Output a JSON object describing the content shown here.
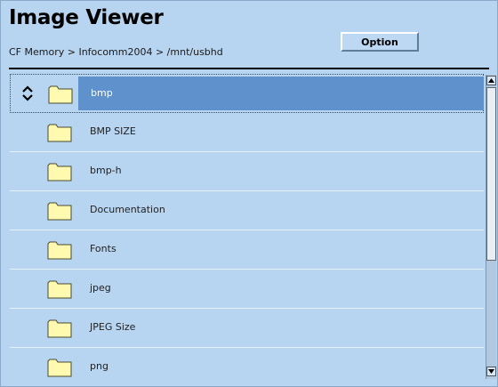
{
  "app": {
    "title": "Image Viewer",
    "breadcrumb": "CF Memory > Infocomm2004 > /mnt/usbhd",
    "option_label": "Option"
  },
  "list": {
    "items": [
      {
        "label": "bmp",
        "icon": "folder-icon",
        "selected": true
      },
      {
        "label": "BMP SIZE",
        "icon": "folder-icon",
        "selected": false
      },
      {
        "label": "bmp-h",
        "icon": "folder-icon",
        "selected": false
      },
      {
        "label": "Documentation",
        "icon": "folder-icon",
        "selected": false
      },
      {
        "label": "Fonts",
        "icon": "folder-icon",
        "selected": false
      },
      {
        "label": "jpeg",
        "icon": "folder-icon",
        "selected": false
      },
      {
        "label": "JPEG Size",
        "icon": "folder-icon",
        "selected": false
      },
      {
        "label": "png",
        "icon": "folder-icon",
        "selected": false
      }
    ]
  },
  "colors": {
    "background": "#b7d5f1",
    "selection": "#5f92cd",
    "folder_fill": "#fffab0"
  }
}
